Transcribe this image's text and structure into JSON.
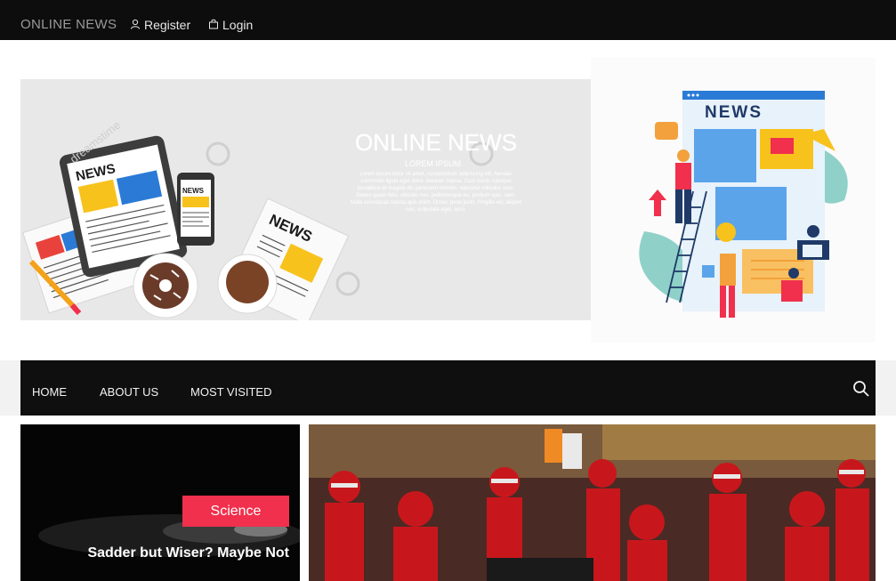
{
  "topbar": {
    "brand": "ONLINE NEWS",
    "register_label": "Register",
    "login_label": "Login"
  },
  "banner_left": {
    "headline": "ONLINE NEWS",
    "sub": "LOREM IPSUM",
    "body": "Lorem ipsum dolor sit amet, consectetuer adipiscing elit. Aenean commodo ligula eget dolor. Aenean massa. Cum sociis natoque penatibus et magnis dis parturient montes, nascetur ridiculus mus. Donec quam felis, ultricies nec, pellentesque eu, pretium quis, sem. Nulla consequat massa quis enim. Donec pede justo, fringilla vel, aliquet nec, vulputate eget, arcu.",
    "tablet_word": "NEWS",
    "phone_word": "NEWS",
    "paper_word": "NEWS",
    "watermark": "dreamstime"
  },
  "banner_right": {
    "headline": "NEWS"
  },
  "nav": {
    "items": [
      "HOME",
      "ABOUT US",
      "MOST VISITED"
    ]
  },
  "featured": {
    "category": "Science",
    "title": "Sadder but Wiser? Maybe Not"
  },
  "colors": {
    "accent": "#f0304c",
    "topbar": "#0d0d0d",
    "navbar": "#0f0f0f"
  },
  "icons": {
    "register": "user-icon",
    "login": "login-icon",
    "search": "search-icon"
  }
}
